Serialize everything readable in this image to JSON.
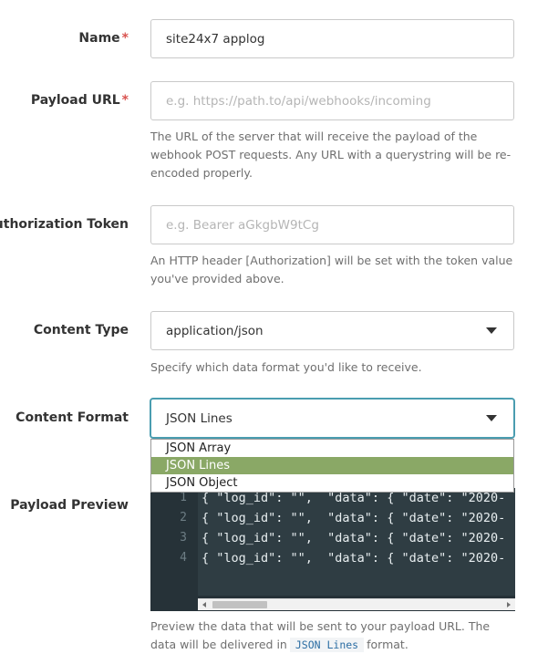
{
  "fields": {
    "name": {
      "label": "Name",
      "required_mark": "*",
      "value": "site24x7 applog"
    },
    "payload_url": {
      "label": "Payload URL",
      "required_mark": "*",
      "value": "",
      "placeholder": "e.g. https://path.to/api/webhooks/incoming",
      "help": "The URL of the server that will receive the payload of the webhook POST requests. Any URL with a querystring will be re-encoded properly."
    },
    "auth_token": {
      "label": "Authorization Token",
      "value": "",
      "placeholder": "e.g. Bearer aGkgbW9tCg",
      "help": "An HTTP header [Authorization] will be set with the token value you've provided above."
    },
    "content_type": {
      "label": "Content Type",
      "value": "application/json",
      "help": "Specify which data format you'd like to receive."
    },
    "content_format": {
      "label": "Content Format",
      "value": "JSON Lines",
      "options": [
        "JSON Array",
        "JSON Lines",
        "JSON Object"
      ],
      "selected_option": "JSON Lines"
    },
    "payload_preview": {
      "label": "Payload Preview",
      "line_numbers": [
        "1",
        "2",
        "3",
        "4"
      ],
      "lines": [
        "{ \"log_id\": \"\",  \"data\": { \"date\": \"2020-",
        "{ \"log_id\": \"\",  \"data\": { \"date\": \"2020-",
        "{ \"log_id\": \"\",  \"data\": { \"date\": \"2020-",
        "{ \"log_id\": \"\",  \"data\": { \"date\": \"2020-"
      ],
      "help_before": "Preview the data that will be sent to your payload URL. The data will be delivered in",
      "help_code": "JSON Lines",
      "help_after": "format."
    }
  },
  "colors": {
    "required": "#d9534f",
    "focus_border": "#4a9db0",
    "selected_option_bg": "#8aa866",
    "editor_bg": "#263238"
  }
}
